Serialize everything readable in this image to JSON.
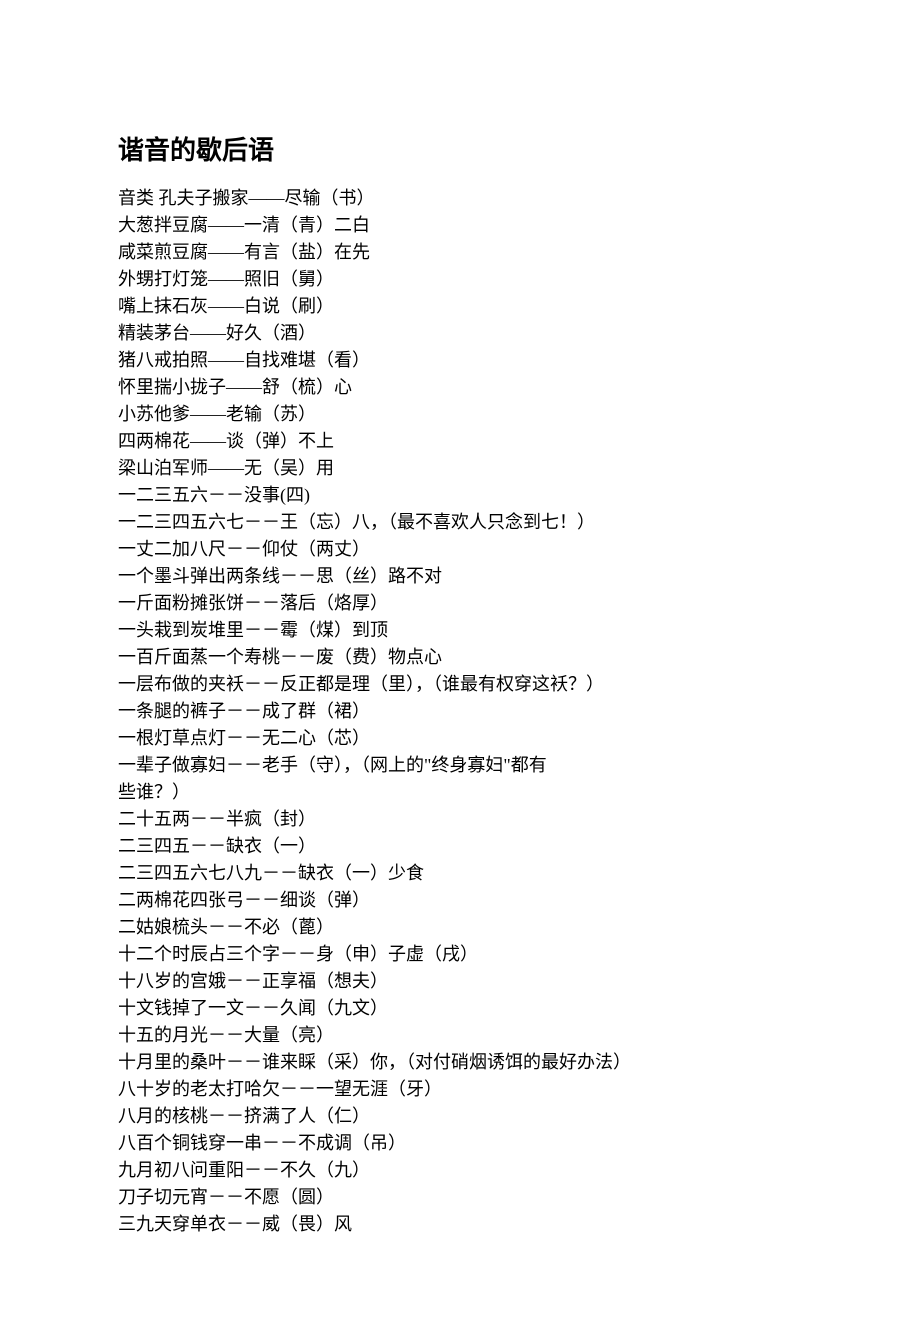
{
  "title": "谐音的歇后语",
  "lines": [
    "音类 孔夫子搬家——尽输（书）",
    "大葱拌豆腐——一清（青）二白",
    "咸菜煎豆腐——有言（盐）在先",
    "外甥打灯笼——照旧（舅）",
    "嘴上抹石灰——白说（刷）",
    "精装茅台——好久（酒）",
    "猪八戒拍照——自找难堪（看）",
    "怀里揣小拢子——舒（梳）心",
    "小苏他爹——老输（苏）",
    "四两棉花——谈（弹）不上",
    "梁山泊军师——无（吴）用",
    "一二三五六－－没事(四)",
    "一二三四五六七－－王（忘）八，（最不喜欢人只念到七！）",
    "一丈二加八尺－－仰仗（两丈）",
    "一个墨斗弹出两条线－－思（丝）路不对",
    "一斤面粉摊张饼－－落后（烙厚）",
    "一头栽到炭堆里－－霉（煤）到顶",
    "一百斤面蒸一个寿桃－－废（费）物点心",
    "一层布做的夹袄－－反正都是理（里），（谁最有权穿这袄？）",
    "一条腿的裤子－－成了群（裙）",
    "一根灯草点灯－－无二心（芯）",
    "一辈子做寡妇－－老手（守），（网上的\"终身寡妇\"都有",
    "些谁？）",
    "二十五两－－半疯（封）",
    "二三四五－－缺衣（一）",
    "二三四五六七八九－－缺衣（一）少食",
    "二两棉花四张弓－－细谈（弹）",
    "二姑娘梳头－－不必（蓖）",
    "十二个时辰占三个字－－身（申）子虚（戌）",
    "十八岁的宫娥－－正享福（想夫）",
    "十文钱掉了一文－－久闻（九文）",
    "十五的月光－－大量（亮）",
    "十月里的桑叶－－谁来睬（采）你，（对付硝烟诱饵的最好办法）",
    "八十岁的老太打哈欠－－一望无涯（牙）",
    "八月的核桃－－挤满了人（仁）",
    "八百个铜钱穿一串－－不成调（吊）",
    "九月初八问重阳－－不久（九）",
    "刀子切元宵－－不愿（圆）",
    "三九天穿单衣－－威（畏）风"
  ]
}
